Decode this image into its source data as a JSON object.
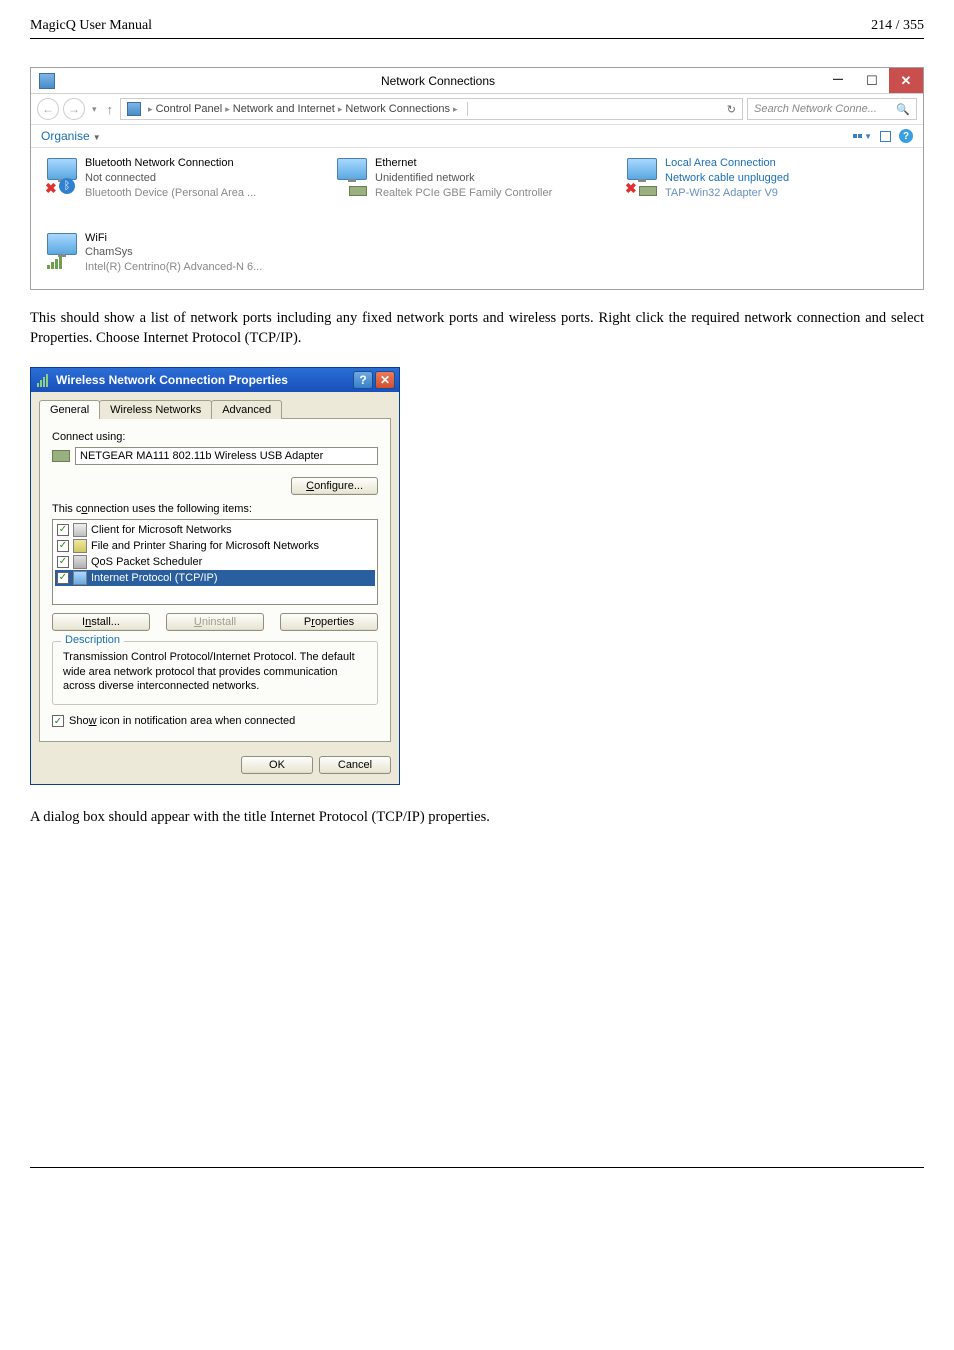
{
  "doc": {
    "title": "MagicQ User Manual",
    "page": "214 / 355"
  },
  "win8": {
    "title": "Network Connections",
    "breadcrumb": {
      "root": "Control Panel",
      "mid": "Network and Internet",
      "leaf": "Network Connections"
    },
    "search_placeholder": "Search Network Conne...",
    "toolbar": {
      "organise": "Organise"
    },
    "conns": {
      "bt": {
        "name": "Bluetooth Network Connection",
        "status": "Not connected",
        "dev": "Bluetooth Device (Personal Area ..."
      },
      "eth": {
        "name": "Ethernet",
        "status": "Unidentified network",
        "dev": "Realtek PCIe GBE Family Controller"
      },
      "lac": {
        "name": "Local Area Connection",
        "status": "Network cable unplugged",
        "dev": "TAP-Win32 Adapter V9"
      },
      "wifi": {
        "name": "WiFi",
        "status": "ChamSys",
        "dev": "Intel(R) Centrino(R) Advanced-N 6..."
      }
    }
  },
  "para1": "This should show a list of network ports including any fixed network ports and wireless ports. Right click the required network connection and select Properties. Choose Internet Protocol (TCP/IP).",
  "xp": {
    "title": "Wireless Network Connection Properties",
    "tabs": {
      "general": "General",
      "wireless": "Wireless Networks",
      "advanced": "Advanced"
    },
    "connect_using": "Connect using:",
    "adapter": "NETGEAR MA111 802.11b Wireless USB Adapter",
    "configure": "Configure...",
    "items_label": "This connection uses the following items:",
    "items": {
      "client": "Client for Microsoft Networks",
      "share": "File and Printer Sharing for Microsoft Networks",
      "qos": "QoS Packet Scheduler",
      "tcpip": "Internet Protocol (TCP/IP)"
    },
    "btns": {
      "install": "Install...",
      "uninstall": "Uninstall",
      "properties": "Properties"
    },
    "desc_title": "Description",
    "desc": "Transmission Control Protocol/Internet Protocol. The default wide area network protocol that provides communication across diverse interconnected networks.",
    "show_icon": "Show icon in notification area when connected",
    "ok": "OK",
    "cancel": "Cancel"
  },
  "para2": "A dialog box should appear with the title Internet Protocol (TCP/IP) properties."
}
